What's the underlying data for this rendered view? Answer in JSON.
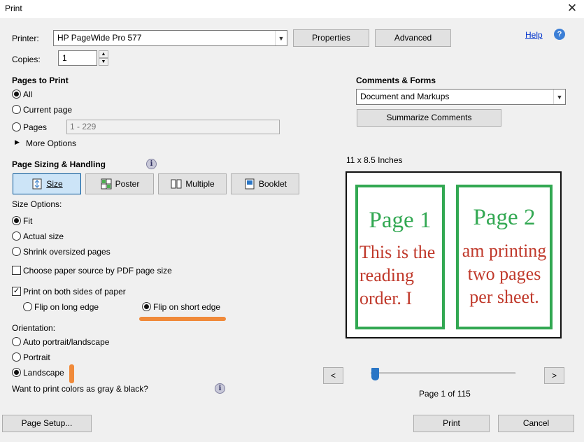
{
  "window": {
    "title": "Print",
    "close_glyph": "✕"
  },
  "printer": {
    "label": "Printer:",
    "selected": "HP PageWide Pro 577",
    "properties_label": "Properties",
    "advanced_label": "Advanced",
    "help_label": "Help",
    "help_glyph": "?"
  },
  "copies": {
    "label": "Copies:",
    "value": "1"
  },
  "pages_to_print": {
    "heading": "Pages to Print",
    "all_label": "All",
    "current_label": "Current page",
    "pages_label": "Pages",
    "pages_value": "1 - 229",
    "more_options_label": "More Options"
  },
  "comments_forms": {
    "heading": "Comments & Forms",
    "selected": "Document and Markups",
    "summarize_label": "Summarize Comments"
  },
  "page_sizing": {
    "heading": "Page Sizing & Handling",
    "info_glyph": "i",
    "tabs": [
      {
        "label": "Size"
      },
      {
        "label": "Poster"
      },
      {
        "label": "Multiple"
      },
      {
        "label": "Booklet"
      }
    ],
    "size_options_label": "Size Options:",
    "fit_label": "Fit",
    "actual_label": "Actual size",
    "shrink_label": "Shrink oversized pages",
    "paper_source_label": "Choose paper source by PDF page size",
    "both_sides_label": "Print on both sides of paper",
    "check_glyph": "✓",
    "flip_long_label": "Flip on long edge",
    "flip_short_label": "Flip on short edge"
  },
  "orientation": {
    "heading": "Orientation:",
    "auto_label": "Auto portrait/landscape",
    "portrait_label": "Portrait",
    "landscape_label": "Landscape"
  },
  "gray": {
    "label": "Want to print colors as gray & black?"
  },
  "preview": {
    "size_label": "11 x 8.5 Inches",
    "page1_title": "Page 1",
    "page1_text": [
      "This is the",
      "reading",
      "order. I"
    ],
    "page2_title": "Page 2",
    "page2_text": [
      "am printing",
      "two pages",
      "per sheet."
    ],
    "prev_glyph": "<",
    "next_glyph": ">",
    "page_indicator": "Page 1 of 115"
  },
  "footer": {
    "page_setup_label": "Page Setup...",
    "print_label": "Print",
    "cancel_label": "Cancel"
  },
  "colors": {
    "highlight_orange": "#f08a3a",
    "page_border_green": "#32a852",
    "page_text_red": "#c0392b",
    "active_tab_blue": "#cce4f7"
  }
}
